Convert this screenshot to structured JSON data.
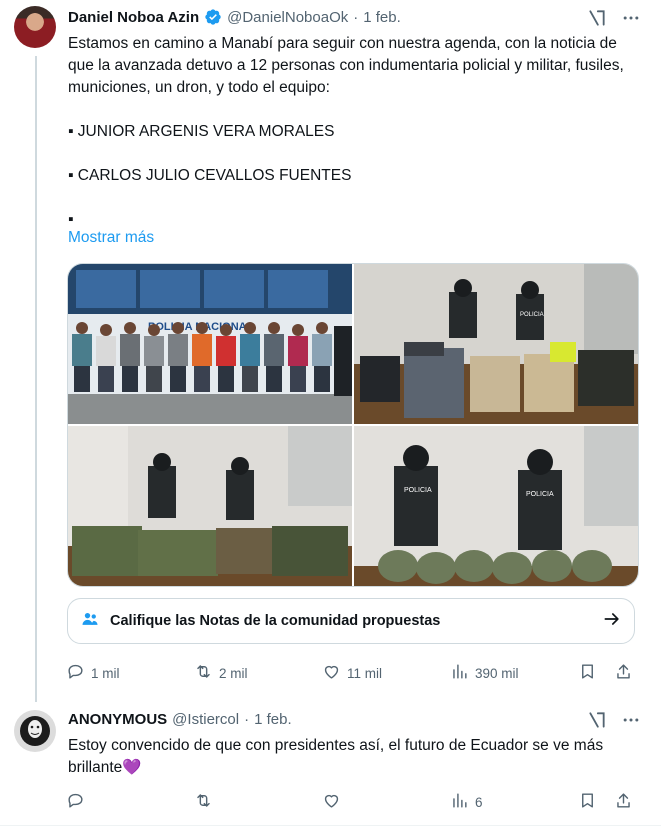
{
  "tweet": {
    "name": "Daniel Noboa Azin",
    "handle": "@DanielNoboaOk",
    "dot": "·",
    "date": "1 feb.",
    "text_intro": "Estamos en camino a Manabí para seguir con nuestra agenda, con la noticia de que la avanzada detuvo a 12 personas con indumentaria policial y militar, fusiles, municiones, un dron, y todo el equipo:",
    "bullets": [
      "▪ JUNIOR ARGENIS VERA MORALES",
      "▪ CARLOS JULIO CEVALLOS FUENTES",
      "▪"
    ],
    "show_more": "Mostrar más",
    "photo_labels": [
      "POLICIA NACIONAL",
      "POLICIA",
      "POLICIA",
      "POLICIA"
    ],
    "community_notes": "Califique las Notas de la comunidad propuestas",
    "stats": {
      "replies": "1 mil",
      "retweets": "2 mil",
      "likes": "11 mil",
      "views": "390 mil"
    }
  },
  "reply": {
    "name": "ANONYMOUS",
    "handle": "@Istiercol",
    "dot": "·",
    "date": "1 feb.",
    "text": "Estoy convencido de que con presidentes así, el futuro de Ecuador se ve más brillante",
    "emoji": "💜",
    "stats": {
      "views": "6"
    }
  },
  "icons": {
    "verified": "verified-badge-icon",
    "grok": "grok-icon",
    "more": "more-icon",
    "people": "community-notes-icon",
    "arrow": "arrow-right-icon",
    "reply": "reply-icon",
    "retweet": "retweet-icon",
    "like": "like-icon",
    "views": "views-icon",
    "bookmark": "bookmark-icon",
    "share": "share-icon"
  },
  "colors": {
    "accent": "#1d9bf0",
    "muted": "#536471",
    "text": "#0f1419",
    "border": "#cfd9de"
  }
}
